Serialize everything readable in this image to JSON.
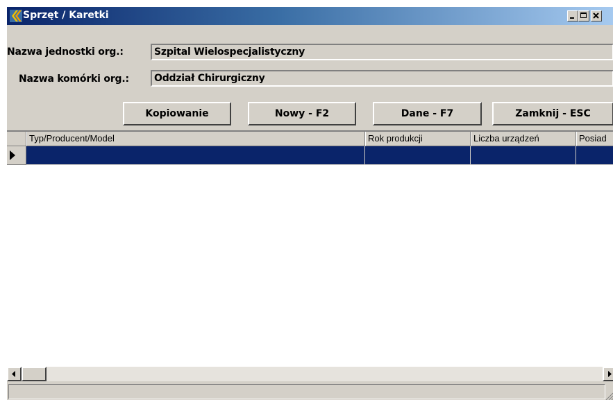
{
  "window": {
    "title": "Sprzęt / Karetki",
    "controls": {
      "minimize": "_",
      "maximize": "□",
      "close": "X"
    }
  },
  "form": {
    "unit_label": "Nazwa jednostki org.:",
    "unit_value": "Szpital Wielospecjalistyczny",
    "cell_label": "Nazwa komórki org.:",
    "cell_value": "Oddział Chirurgiczny"
  },
  "toolbar": {
    "copy_label": "Kopiowanie",
    "new_label": "Nowy - F2",
    "data_label": "Dane - F7",
    "close_label": "Zamknij - ESC"
  },
  "grid": {
    "columns": [
      "Typ/Producent/Model",
      "Rok produkcji",
      "Liczba urządzeń",
      "Posiad"
    ],
    "rows": [
      [
        "",
        "",
        "",
        ""
      ]
    ]
  },
  "colors": {
    "selection": "#0a246a",
    "face": "#d4d0c8",
    "title_start": "#0a246a",
    "title_end": "#a6caf0"
  },
  "icons": [
    "app-icon",
    "minimize-icon",
    "maximize-icon",
    "close-icon",
    "row-pointer-icon",
    "scroll-left-icon",
    "scroll-right-icon",
    "resize-grip-icon"
  ]
}
